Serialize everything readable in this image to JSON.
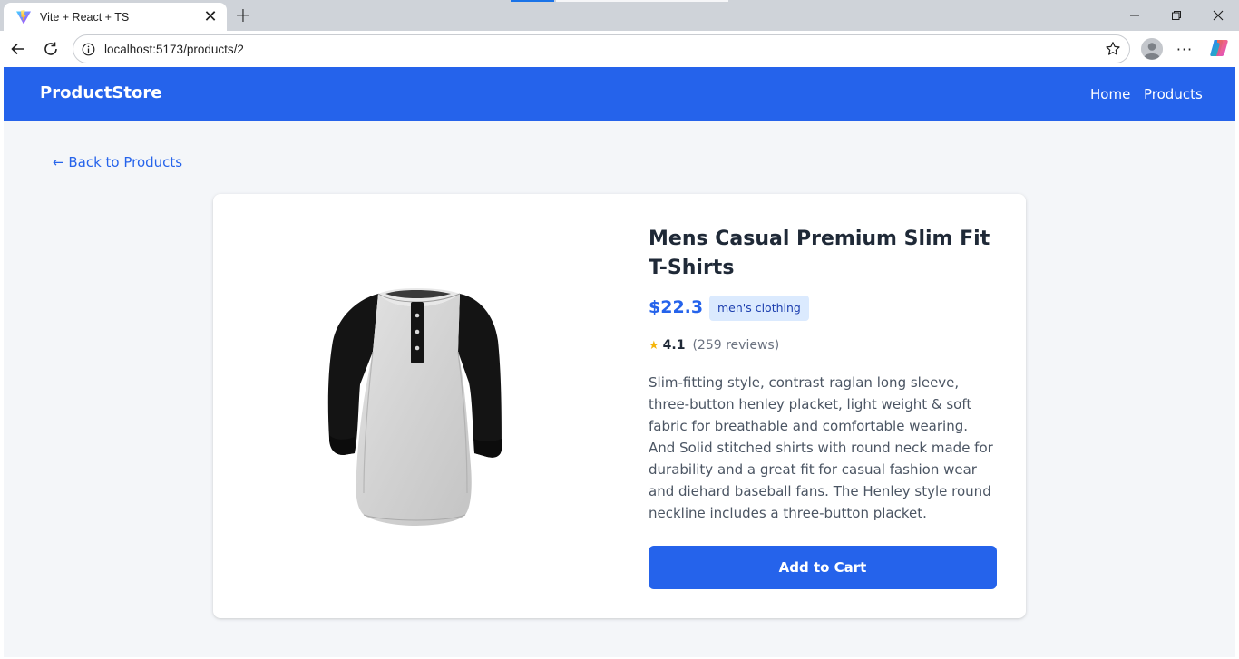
{
  "browser": {
    "tab_title": "Vite + React + TS",
    "url": "localhost:5173/products/2"
  },
  "site": {
    "brand": "ProductStore",
    "nav": [
      {
        "label": "Home"
      },
      {
        "label": "Products"
      }
    ]
  },
  "page": {
    "back_link": "← Back to Products"
  },
  "product": {
    "title": "Mens Casual Premium Slim Fit T-Shirts",
    "price": "$22.3",
    "category": "men's clothing",
    "rating_star": "★",
    "rating": "4.1",
    "reviews": "(259 reviews)",
    "description": "Slim-fitting style, contrast raglan long sleeve, three-button henley placket, light weight & soft fabric for breathable and comfortable wearing. And Solid stitched shirts with round neck made for durability and a great fit for casual fashion wear and diehard baseball fans. The Henley style round neckline includes a three-button placket.",
    "add_to_cart": "Add to Cart",
    "image_icon": "raglan-henley-shirt-image"
  },
  "colors": {
    "primary": "#2563eb",
    "badge_bg": "#dbeafe",
    "badge_text": "#1e40af",
    "star": "#f5b50a",
    "page_bg": "#f4f6f9"
  }
}
